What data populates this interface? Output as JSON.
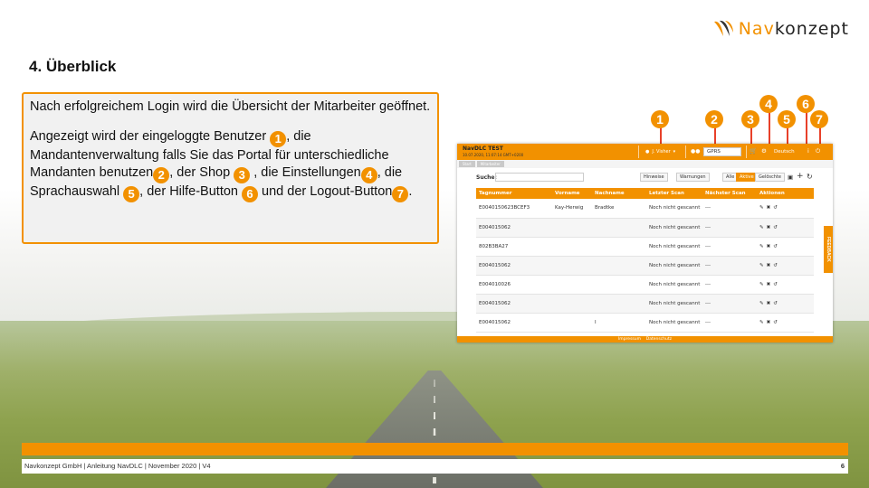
{
  "logo": {
    "prefix": "Nav",
    "suffix": "konzept"
  },
  "title": "4. Überblick",
  "intro": "Nach erfolgreichem Login wird die Übersicht der Mitarbeiter geöffnet.",
  "description": {
    "part1": "Angezeigt wird der eingeloggte Benutzer ",
    "part2": ", die Mandantenverwaltung falls Sie das Portal für unterschiedliche Mandanten benutzen",
    "part3": ", der Shop ",
    "part4": " , die Einstellungen",
    "part5": ", die Sprachauswahl ",
    "part6": ", der Hilfe-Button ",
    "part7": " und der Logout-Button",
    "part8": "."
  },
  "markers": [
    "1",
    "2",
    "3",
    "4",
    "5",
    "6",
    "7"
  ],
  "app": {
    "brand": "NavDLC TEST",
    "datetime": "10.07.2020, 11:07:14 GMT+0200",
    "user": "J. Visher",
    "mandant": "GPRS",
    "language": "Deutsch",
    "breadcrumb": [
      "Start",
      "Mitarbeiter"
    ],
    "search_label": "Suche:",
    "filters": [
      "Hinweise",
      "Warnungen"
    ],
    "states": [
      "Alle",
      "Aktive",
      "Gelöschte"
    ],
    "columns": [
      "Tagnummer",
      "Vorname",
      "Nachname",
      "Letzter Scan",
      "Nächster Scan",
      "Aktionen"
    ],
    "rows": [
      {
        "tag": "E0040150623BCEF3",
        "first": "Kay-Herwig",
        "last": "Bradtke",
        "last_scan": "Noch nicht gescannt",
        "next_scan": "---"
      },
      {
        "tag": "E004015062",
        "first": "",
        "last": "",
        "last_scan": "Noch nicht gescannt",
        "next_scan": "---"
      },
      {
        "tag": "802B3BA27",
        "first": "",
        "last": "",
        "last_scan": "Noch nicht gescannt",
        "next_scan": "---"
      },
      {
        "tag": "E004015062",
        "first": "",
        "last": "",
        "last_scan": "Noch nicht gescannt",
        "next_scan": "---"
      },
      {
        "tag": "E004010026",
        "first": "",
        "last": "",
        "last_scan": "Noch nicht gescannt",
        "next_scan": "---"
      },
      {
        "tag": "E004015062",
        "first": "",
        "last": "",
        "last_scan": "Noch nicht gescannt",
        "next_scan": "---"
      },
      {
        "tag": "E004015062",
        "first": "",
        "last": "I",
        "last_scan": "Noch nicht gescannt",
        "next_scan": "---"
      }
    ],
    "footer_links": [
      "Impressum",
      "Datenschutz"
    ],
    "feedback": "FEEDBACK"
  },
  "footer": {
    "text": "Navkonzept GmbH  |  Anleitung NavDLC  |  November 2020  |  V4",
    "page": "6"
  },
  "colors": {
    "accent": "#f29100",
    "marker_line": "#e8412a"
  }
}
